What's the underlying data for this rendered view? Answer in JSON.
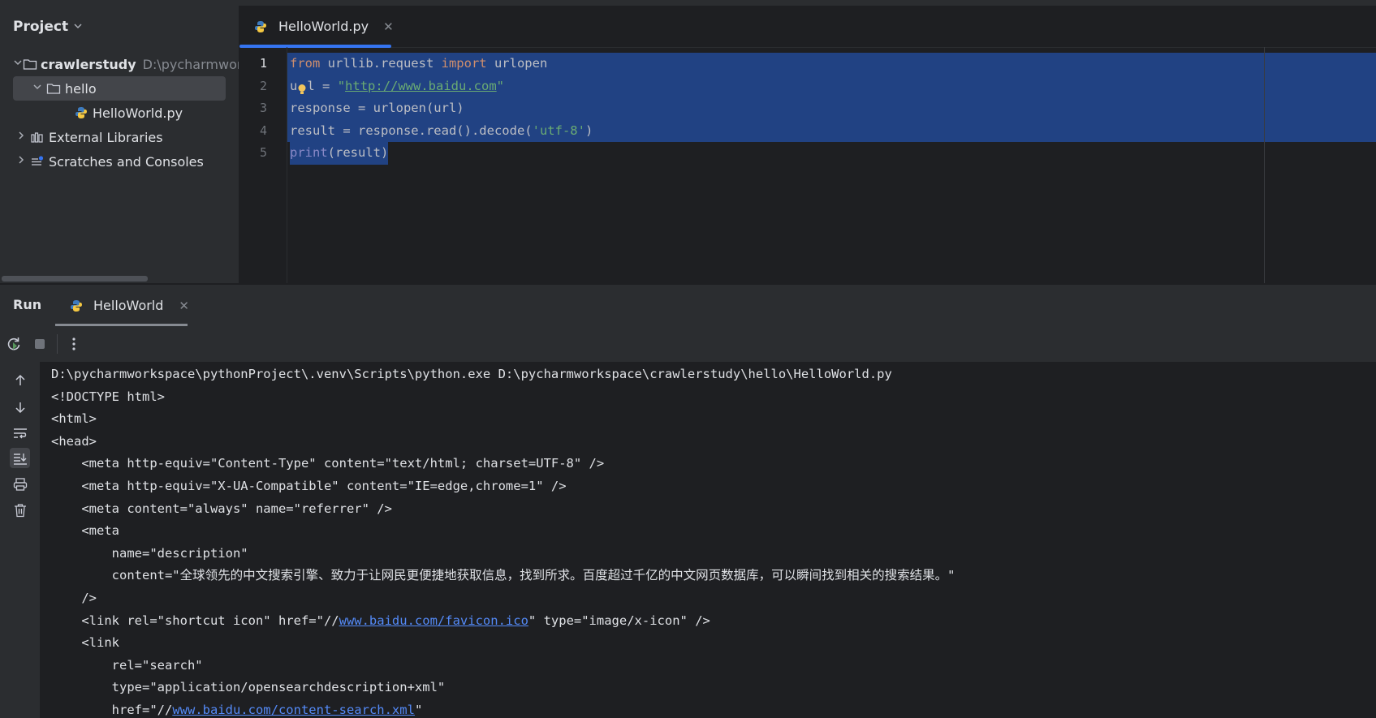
{
  "project_pane": {
    "title": "Project",
    "tree": [
      {
        "label": "crawlerstudy",
        "path": "D:\\pycharmwor"
      },
      {
        "label": "hello"
      },
      {
        "label": "HelloWorld.py"
      },
      {
        "label": "External Libraries"
      },
      {
        "label": "Scratches and Consoles"
      }
    ]
  },
  "editor": {
    "tab_label": "HelloWorld.py",
    "line_numbers": [
      "1",
      "2",
      "3",
      "4",
      "5"
    ],
    "code": {
      "l1_kw1": "from",
      "l1_mod": " urllib.request ",
      "l1_kw2": "import",
      "l1_name": " urlopen",
      "l2_pre": "u",
      "l2_mid": "l",
      "l2_eq": " = ",
      "l2_q1": "\"",
      "l2_url": "http://www.baidu.com",
      "l2_q2": "\"",
      "l3": "response = urlopen(url)",
      "l4_pre": "result = response.read().decode(",
      "l4_str": "'utf-8'",
      "l4_post": ")",
      "l5_fn": "print",
      "l5_rest": "(result)"
    }
  },
  "run_panel": {
    "title": "Run",
    "tab_label": "HelloWorld"
  },
  "console": {
    "l1": "D:\\pycharmworkspace\\pythonProject\\.venv\\Scripts\\python.exe D:\\pycharmworkspace\\crawlerstudy\\hello\\HelloWorld.py",
    "l2": "<!DOCTYPE html>",
    "l3": "<html>",
    "l4": "<head>",
    "l5": "    <meta http-equiv=\"Content-Type\" content=\"text/html; charset=UTF-8\" />",
    "l6": "    <meta http-equiv=\"X-UA-Compatible\" content=\"IE=edge,chrome=1\" />",
    "l7": "    <meta content=\"always\" name=\"referrer\" />",
    "l8": "    <meta",
    "l9": "        name=\"description\"",
    "l10": "        content=\"全球领先的中文搜索引擎、致力于让网民更便捷地获取信息，找到所求。百度超过千亿的中文网页数据库，可以瞬间找到相关的搜索结果。\"",
    "l11": "    />",
    "l12_pre": "    <link rel=\"shortcut icon\" href=\"//",
    "l12_link": "www.baidu.com/favicon.ico",
    "l12_post": "\" type=\"image/x-icon\" />",
    "l13": "    <link",
    "l14": "        rel=\"search\"",
    "l15": "        type=\"application/opensearchdescription+xml\"",
    "l16_pre": "        href=\"//",
    "l16_link": "www.baidu.com/content-search.xml",
    "l16_post": "\""
  },
  "colors": {
    "background": "#1e1f22",
    "panel": "#2b2d30",
    "selection": "#214283",
    "accent": "#3574f0",
    "keyword": "#cf8e6d",
    "string": "#6aab73",
    "link": "#548af7"
  },
  "icons": [
    "chevron-down-icon",
    "folder-icon",
    "python-file-icon",
    "libraries-icon",
    "scratches-icon",
    "rerun-icon",
    "stop-icon",
    "more-icon",
    "arrow-up-icon",
    "arrow-down-icon",
    "soft-wrap-icon",
    "scroll-to-end-icon",
    "print-icon",
    "trash-icon",
    "close-icon",
    "bulb-icon"
  ]
}
